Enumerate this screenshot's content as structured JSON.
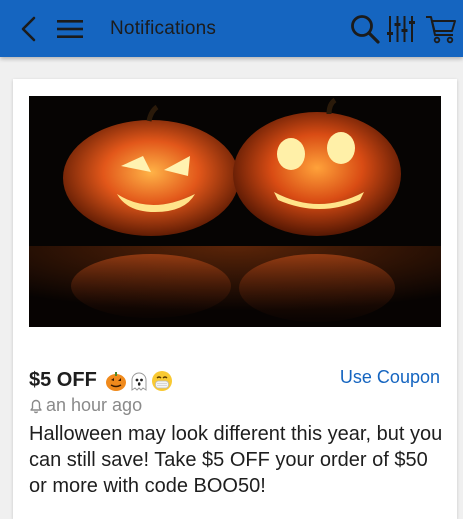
{
  "header": {
    "title": "Notifications",
    "colors": {
      "bar": "#1565c0",
      "icon": "#1b1b1b"
    },
    "icons": [
      "back-arrow-icon",
      "menu-icon",
      "search-icon",
      "filter-icon",
      "cart-icon"
    ]
  },
  "notification": {
    "offer_title": "$5 OFF",
    "emojis": [
      "jack-o-lantern-emoji",
      "ghost-emoji",
      "mask-face-emoji"
    ],
    "action_label": "Use Coupon",
    "time": "an hour ago",
    "body": "Halloween may look different this year, but you can still save! Take $5 OFF your order of $50 or more with code BOO50!",
    "accent": "#1565c0",
    "image": "halloween-pumpkins-photo"
  }
}
